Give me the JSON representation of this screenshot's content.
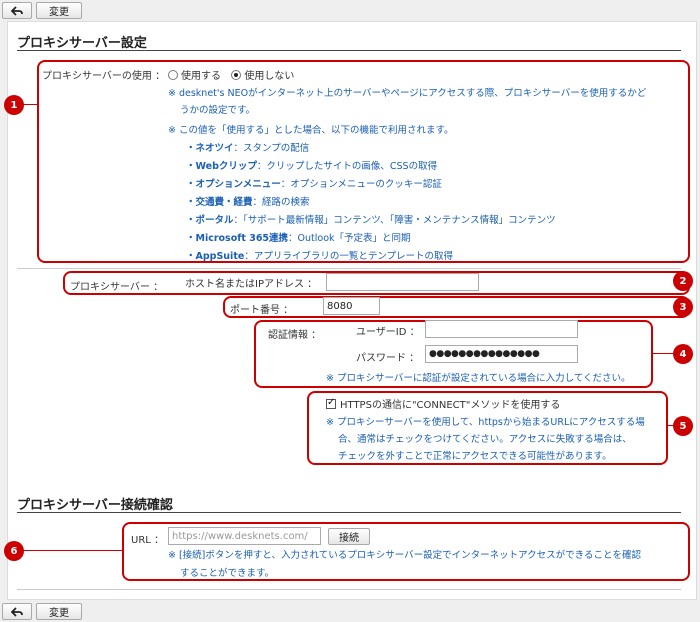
{
  "toolbar": {
    "back_icon": "back-arrow-icon",
    "change_label": "変更"
  },
  "proxy": {
    "title": "プロキシサーバー設定",
    "usage_label": "プロキシサーバーの使用 ：",
    "use_option": "使用する",
    "nouse_option": "使用しない",
    "selected": "使用しない",
    "note1_line1": "※ desknet's NEOがインターネット上のサーバーやページにアクセスする際、プロキシサーバーを使用するかど",
    "note1_line2": "うかの設定です。",
    "note2": "※ この値を「使用する」とした場合、以下の機能で利用されます。",
    "features": [
      {
        "name": "・ネオツイ",
        "desc": "：スタンプの配信"
      },
      {
        "name": "・Webクリップ",
        "desc": "：クリップしたサイトの画像、CSSの取得"
      },
      {
        "name": "・オプションメニュー",
        "desc": "：オプションメニューのクッキー認証"
      },
      {
        "name": "・交通費・経費",
        "desc": "：経路の検索"
      },
      {
        "name": "・ポータル",
        "desc": "：「サポート最新情報」コンテンツ、「障害・メンテナンス情報」コンテンツ"
      },
      {
        "name": "・Microsoft 365連携",
        "desc": "：Outlook「予定表」と同期"
      },
      {
        "name": "・AppSuite",
        "desc": "：アプリライブラリの一覧とテンプレートの取得"
      }
    ],
    "server_label": "プロキシサーバー ：",
    "host_label": "ホスト名またはIPアドレス ：",
    "host_value": "",
    "port_label": "ポート番号 ：",
    "port_value": "8080",
    "auth_label": "認証情報 ：",
    "user_label": "ユーザーID ：",
    "user_value": "",
    "password_label": "パスワード ：",
    "password_value": "●●●●●●●●●●●●●●●",
    "auth_note": "※ プロキシサーバーに認証が設定されている場合に入力してください。",
    "https_label": "HTTPSの通信に\"CONNECT\"メソッドを使用する",
    "https_checked": true,
    "https_note1": "※ プロキシーサーバーを使用して、httpsから始まるURLにアクセスする場",
    "https_note2": "合、通常はチェックをつけてください。アクセスに失敗する場合は、",
    "https_note3": "チェックを外すことで正常にアクセスできる可能性があります。"
  },
  "connection": {
    "title": "プロキシサーバー接続確認",
    "url_label": "URL ：",
    "url_placeholder": "https://www.desknets.com/",
    "connect_label": "接続",
    "note1": "※ [接続]ボタンを押すと、入力されているプロキシサーバー設定でインターネットアクセスができることを確認",
    "note2": "することができます。"
  },
  "badges": [
    "1",
    "2",
    "3",
    "4",
    "5",
    "6"
  ]
}
